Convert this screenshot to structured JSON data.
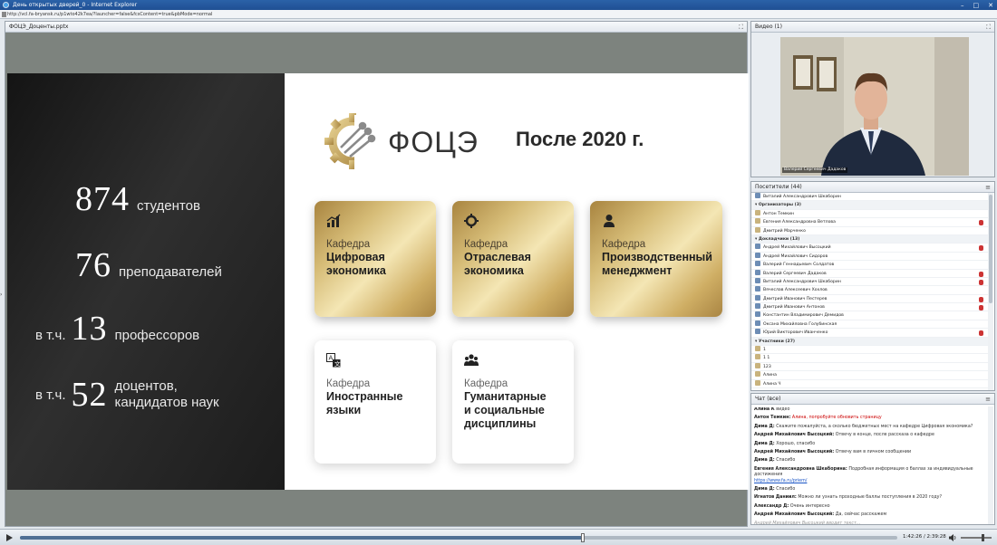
{
  "window": {
    "title": "День открытых дверей_0 - Internet Explorer",
    "url": "http://vcl.fa-bryansk.ru/p1wto42k7ea/?launcher=false&fcsContent=true&pbMode=normal"
  },
  "presentation": {
    "pod_title": "ФОЦЭ_Доценты.pptx",
    "slide": {
      "logo_text": "ФОЦЭ",
      "title": "После 2020 г.",
      "stats": [
        {
          "prefix": "",
          "number": "874",
          "label": "студентов"
        },
        {
          "prefix": "",
          "number": "76",
          "label": "преподавателей"
        },
        {
          "prefix": "в т.ч.",
          "number": "13",
          "label": "профессоров"
        },
        {
          "prefix": "в т.ч.",
          "number": "52",
          "label": "доцентов,",
          "label2": "кандидатов наук"
        }
      ],
      "cards": [
        {
          "kaf": "Кафедра",
          "line1": "Цифровая",
          "line2": "экономика",
          "line3": "",
          "icon": "bar-chart-icon"
        },
        {
          "kaf": "Кафедра",
          "line1": "Отраслевая",
          "line2": "экономика",
          "line3": "",
          "icon": "gear-icon"
        },
        {
          "kaf": "Кафедра",
          "line1": "Производственный",
          "line2": "менеджмент",
          "line3": "",
          "icon": "person-icon"
        },
        {
          "kaf": "Кафедра",
          "line1": "Иностранные",
          "line2": "языки",
          "line3": "",
          "icon": "translate-icon"
        },
        {
          "kaf": "Кафедра",
          "line1": "Гуманитарные",
          "line2": "и социальные",
          "line3": "дисциплины",
          "icon": "group-icon"
        }
      ]
    }
  },
  "video": {
    "pod_title": "Видео",
    "count": "(1)",
    "caption": "Валерий Сергеевич Дадаков"
  },
  "attendees": {
    "pod_title": "Посетители",
    "count": "(44)",
    "rows": [
      {
        "type": "host",
        "text": "Виталий Александрович Шкаборин",
        "mic": false
      },
      {
        "type": "group",
        "text": "Организаторы (3)",
        "mic": false
      },
      {
        "type": "user",
        "text": "Антон Темкин",
        "mic": false
      },
      {
        "type": "user",
        "text": "Евгения Александровна Ветлова",
        "mic": true
      },
      {
        "type": "user",
        "text": "Дмитрий Марченко",
        "mic": false
      },
      {
        "type": "group",
        "text": "Докладчики (13)",
        "mic": false
      },
      {
        "type": "host",
        "text": "Андрей Михайлович Высоцкий",
        "mic": true
      },
      {
        "type": "host",
        "text": "Андрей Михайлович Сидоров",
        "mic": false
      },
      {
        "type": "host",
        "text": "Валерий Геннадьевич Солдатов",
        "mic": false
      },
      {
        "type": "host",
        "text": "Валерий Сергеевич Дадаков",
        "mic": true
      },
      {
        "type": "host",
        "text": "Виталий Александрович Шкаборин",
        "mic": true
      },
      {
        "type": "host",
        "text": "Вячеслав Алексеевич Хохлов",
        "mic": false
      },
      {
        "type": "host",
        "text": "Дмитрий Иванович Пестерев",
        "mic": true
      },
      {
        "type": "host",
        "text": "Дмитрий Иванович Антонов",
        "mic": true
      },
      {
        "type": "host",
        "text": "Константин Владимирович Демидов",
        "mic": false
      },
      {
        "type": "host",
        "text": "Оксана Михайловна Голубинская",
        "mic": false
      },
      {
        "type": "host",
        "text": "Юрий Викторович Иванченко",
        "mic": true
      },
      {
        "type": "group",
        "text": "Участники (27)",
        "mic": false
      },
      {
        "type": "user",
        "text": "1",
        "mic": false
      },
      {
        "type": "user",
        "text": "1 1",
        "mic": false
      },
      {
        "type": "user",
        "text": "123",
        "mic": false
      },
      {
        "type": "user",
        "text": "Алина",
        "mic": false
      },
      {
        "type": "user",
        "text": "Алина Ч",
        "mic": false
      }
    ]
  },
  "chat": {
    "pod_title": "Чат",
    "count": "(все)",
    "messages": [
      {
        "name": "Алина К",
        "text": "видео",
        "style": ""
      },
      {
        "name": "Антон Темкин:",
        "text": "Алина, попробуйте обновить страницу",
        "style": "red"
      },
      {
        "name": "Дима Д:",
        "text": "Скажите пожалуйста, а сколько бюджетных мест на кафедре Цифровая экономика?",
        "style": ""
      },
      {
        "name": "Андрей Михайлович Высоцкий:",
        "text": "Отвечу в конце, после рассказа о кафедре",
        "style": ""
      },
      {
        "name": "Дима Д:",
        "text": "Хорошо, спасибо",
        "style": ""
      },
      {
        "name": "Андрей Михайлович Высоцкий:",
        "text": "Отвечу вам в личном сообщении",
        "style": ""
      },
      {
        "name": "Дима Д:",
        "text": "Спасибо",
        "style": ""
      },
      {
        "name": "Евгения Александровна Шкаборина:",
        "text": "Подробная информация о баллах за индивидуальные достижения",
        "style": "",
        "link": "https://www.fa.ru/priem/"
      },
      {
        "name": "Дима Д:",
        "text": "Спасибо",
        "style": ""
      },
      {
        "name": "Игнатов Даниил:",
        "text": "Можно ли узнать проходные баллы поступления в 2020 году?",
        "style": ""
      },
      {
        "name": "Александр Д:",
        "text": "Очень интересно",
        "style": ""
      },
      {
        "name": "Андрей Михайлович Высоцкий:",
        "text": "Да, сейчас расскажем",
        "style": ""
      },
      {
        "name": "",
        "text": "Андрей Михайлович Высоцкий вводит текст...",
        "style": "typing"
      }
    ]
  },
  "player": {
    "timecode": "1:42:26 / 2:39:28",
    "progress_pct": 64.2,
    "volume_pct": 70
  }
}
